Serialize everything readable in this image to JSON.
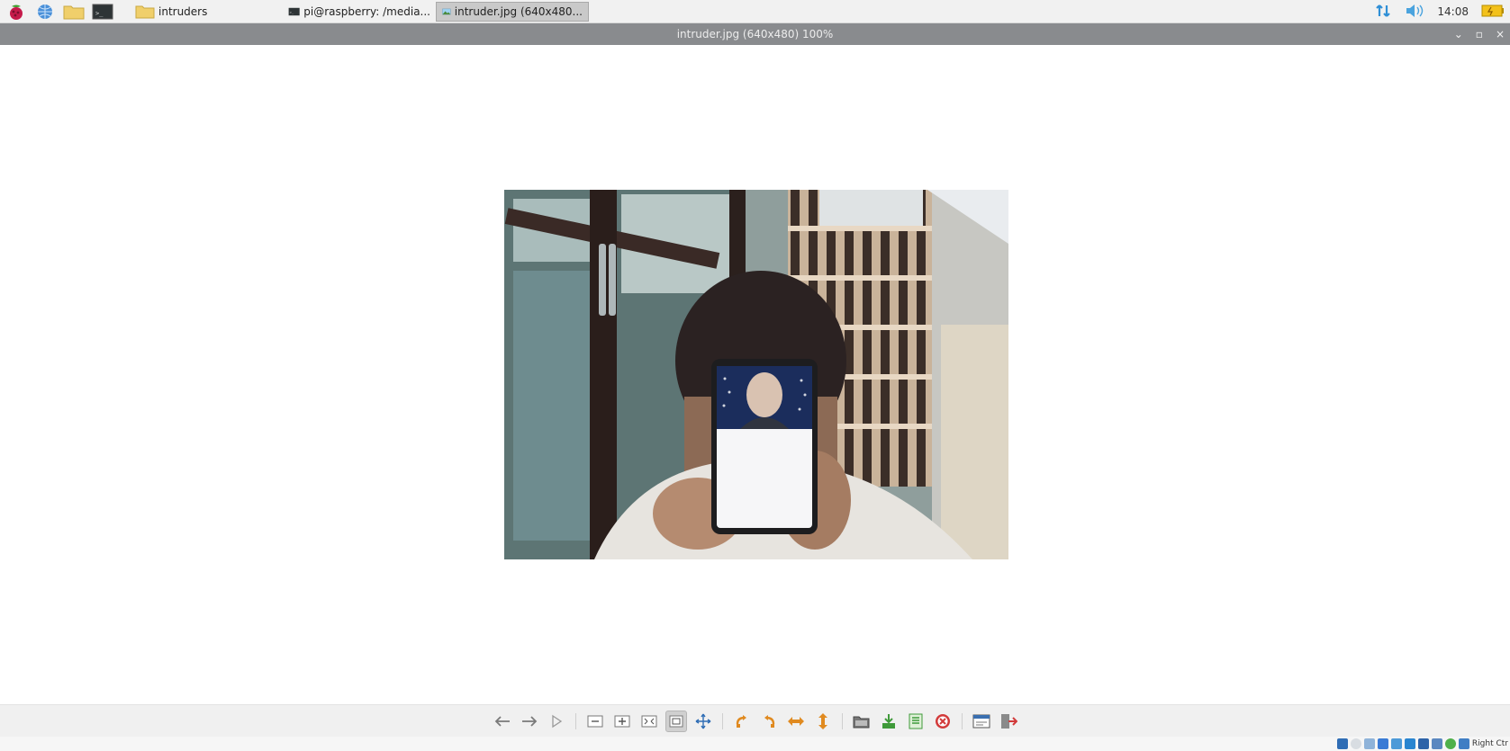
{
  "panel": {
    "launchers": [
      {
        "icon": "raspberry-menu-icon"
      },
      {
        "icon": "globe-browser-icon"
      },
      {
        "icon": "folder-file-manager-icon"
      },
      {
        "icon": "terminal-icon"
      }
    ],
    "tasks": [
      {
        "icon": "folder-icon",
        "label": "intruders",
        "active": false
      },
      {
        "icon": "terminal-icon",
        "label": "pi@raspberry: /media...",
        "active": false
      },
      {
        "icon": "image-viewer-icon",
        "label": "intruder.jpg (640x480...",
        "active": true
      }
    ],
    "tray": {
      "network_icon": "network-arrows-icon",
      "volume_icon": "volume-icon",
      "clock": "14:08",
      "battery_icon": "battery-icon"
    }
  },
  "window": {
    "title": "intruder.jpg (640x480) 100%",
    "controls": {
      "minimize": "⌄",
      "maximize": "▫",
      "close": "×"
    }
  },
  "image": {
    "description_icon": "webcam-photo-icon"
  },
  "toolbar": {
    "buttons": [
      {
        "icon": "back-arrow-icon",
        "name": "previous-image-button"
      },
      {
        "icon": "forward-arrow-icon",
        "name": "next-image-button"
      },
      {
        "icon": "play-slideshow-icon",
        "name": "slideshow-button"
      },
      {
        "icon": "zoom-out-icon",
        "name": "zoom-out-button"
      },
      {
        "icon": "zoom-in-icon",
        "name": "zoom-in-button"
      },
      {
        "icon": "fit-window-icon",
        "name": "fit-window-button"
      },
      {
        "icon": "original-size-icon",
        "name": "original-size-button",
        "pressed": true
      },
      {
        "icon": "fullscreen-icon",
        "name": "fullscreen-button"
      },
      {
        "icon": "rotate-ccw-icon",
        "name": "rotate-left-button"
      },
      {
        "icon": "rotate-cw-icon",
        "name": "rotate-right-button"
      },
      {
        "icon": "flip-horizontal-icon",
        "name": "flip-horizontal-button"
      },
      {
        "icon": "flip-vertical-icon",
        "name": "flip-vertical-button"
      },
      {
        "icon": "open-file-icon",
        "name": "open-file-button"
      },
      {
        "icon": "save-file-icon",
        "name": "save-file-button"
      },
      {
        "icon": "save-as-icon",
        "name": "save-as-button"
      },
      {
        "icon": "delete-icon",
        "name": "delete-button"
      },
      {
        "icon": "preferences-icon",
        "name": "preferences-button"
      },
      {
        "icon": "exit-icon",
        "name": "exit-button"
      }
    ]
  },
  "bottom_tray": {
    "text": "Right Ctr"
  },
  "colors": {
    "panel_bg": "#f1f1f1",
    "titlebar_bg": "#898b8e",
    "toolbar_bg": "#f0f0f0",
    "orange_icon": "#e08a20",
    "green_icon": "#3f9a3a",
    "red_icon": "#d23a3a"
  }
}
